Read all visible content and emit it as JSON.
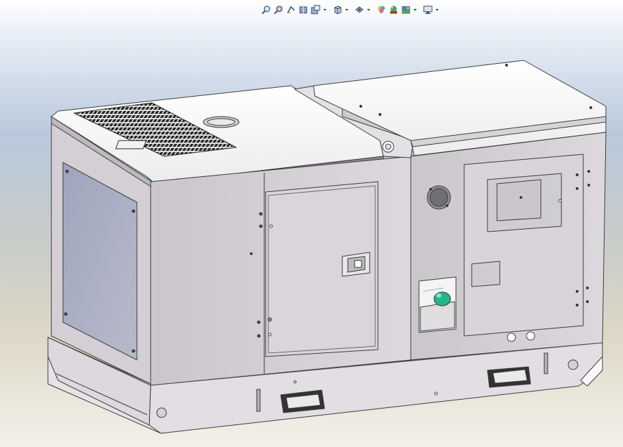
{
  "heads_up_toolbar": {
    "items": [
      {
        "type": "button",
        "icon": "zoom-to-fit-icon"
      },
      {
        "type": "button",
        "icon": "zoom-to-area-icon"
      },
      {
        "type": "button",
        "icon": "previous-view-icon"
      },
      {
        "type": "button",
        "icon": "section-view-icon"
      },
      {
        "type": "button",
        "icon": "dynamic-annotation-views-icon"
      },
      {
        "type": "dropdown",
        "icon": "chevron-down-icon"
      },
      {
        "type": "button",
        "icon": "view-orientation-icon"
      },
      {
        "type": "dropdown",
        "icon": "chevron-down-icon"
      },
      {
        "type": "button",
        "icon": "display-style-icon"
      },
      {
        "type": "dropdown",
        "icon": "chevron-down-icon"
      },
      {
        "type": "button",
        "icon": "hide-show-items-icon"
      },
      {
        "type": "button",
        "icon": "edit-appearance-icon"
      },
      {
        "type": "button",
        "icon": "apply-scene-icon"
      },
      {
        "type": "dropdown",
        "icon": "chevron-down-icon"
      },
      {
        "type": "button",
        "icon": "view-settings-icon"
      },
      {
        "type": "dropdown",
        "icon": "chevron-down-icon"
      }
    ]
  },
  "model": {
    "subject": "generator-enclosure",
    "colors": {
      "panel": "#d6d2d7",
      "panel_dark": "#b9b4ba",
      "panel_light": "#eceaee",
      "roof": "#f7f7f7",
      "glass": "#a9aec3",
      "grille": "#2a2a2a",
      "outline": "#3a3a3a",
      "accent_green": "#25b58a"
    }
  }
}
